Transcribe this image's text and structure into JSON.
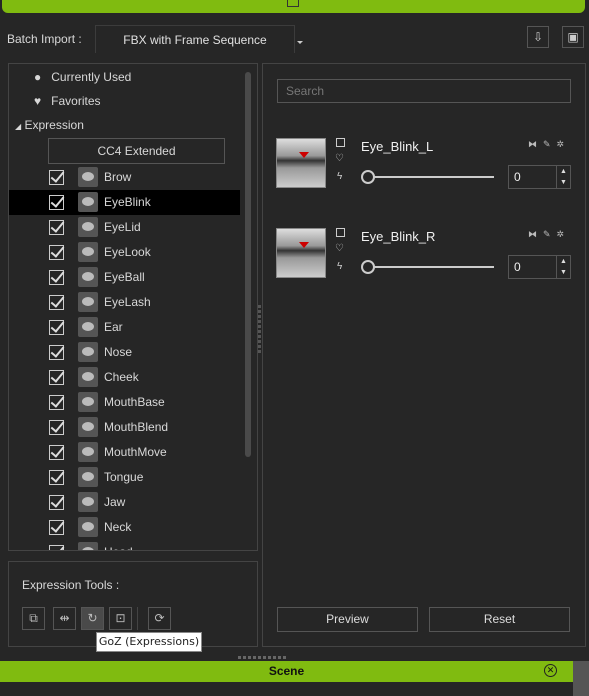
{
  "header": {
    "batch_import_label": "Batch Import :",
    "batch_import_value": "FBX with Frame Sequence"
  },
  "tree": {
    "currently_used": "Currently Used",
    "favorites": "Favorites",
    "expression": "Expression",
    "cc4_button": "CC4 Extended",
    "items": [
      {
        "label": "Brow",
        "checked": true
      },
      {
        "label": "EyeBlink",
        "checked": true,
        "selected": true
      },
      {
        "label": "EyeLid",
        "checked": true
      },
      {
        "label": "EyeLook",
        "checked": true
      },
      {
        "label": "EyeBall",
        "checked": true
      },
      {
        "label": "EyeLash",
        "checked": true
      },
      {
        "label": "Ear",
        "checked": true
      },
      {
        "label": "Nose",
        "checked": true
      },
      {
        "label": "Cheek",
        "checked": true
      },
      {
        "label": "MouthBase",
        "checked": true
      },
      {
        "label": "MouthBlend",
        "checked": true
      },
      {
        "label": "MouthMove",
        "checked": true
      },
      {
        "label": "Tongue",
        "checked": true
      },
      {
        "label": "Jaw",
        "checked": true
      },
      {
        "label": "Neck",
        "checked": true
      },
      {
        "label": "Head",
        "checked": true
      }
    ]
  },
  "right": {
    "search_placeholder": "Search",
    "morphs": [
      {
        "name": "Eye_Blink_L",
        "value": "0"
      },
      {
        "name": "Eye_Blink_R",
        "value": "0"
      }
    ],
    "preview": "Preview",
    "reset": "Reset"
  },
  "tools": {
    "label": "Expression Tools :",
    "tooltip": "GoZ (Expressions)"
  },
  "scene": {
    "title": "Scene"
  },
  "colors": {
    "accent": "#80bb10",
    "background": "#262626",
    "marker": "#cc0000"
  }
}
